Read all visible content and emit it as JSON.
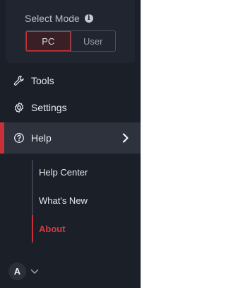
{
  "mode": {
    "title": "Select Mode",
    "info_icon": "info-icon",
    "options": [
      "PC",
      "User"
    ],
    "selected": "PC"
  },
  "nav": {
    "tools": "Tools",
    "settings": "Settings",
    "help": "Help"
  },
  "help_submenu": {
    "items": [
      "Help Center",
      "What's New",
      "About"
    ],
    "active": "About"
  },
  "account": {
    "avatar_letter": "A"
  },
  "colors": {
    "sidebar_bg": "#1b1f28",
    "accent": "#c9313a",
    "active_row": "#2d323d"
  }
}
